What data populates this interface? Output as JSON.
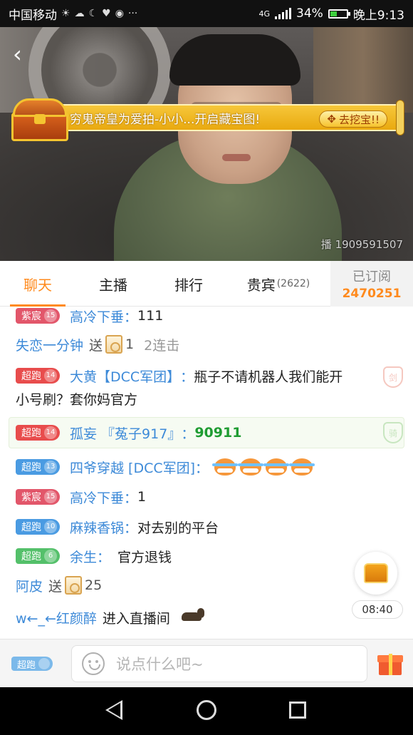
{
  "status_bar": {
    "carrier": "中国移动",
    "network": "4G",
    "battery": "34%",
    "time": "晚上9:13"
  },
  "stream": {
    "watermark": "播 1909591507"
  },
  "banner": {
    "text_parts": [
      "穷鬼帝皇",
      " 为 ",
      "爱拍-小小...",
      "开启藏宝图!"
    ],
    "dig_label": "去挖宝!!"
  },
  "tabs": [
    {
      "label": "聊天",
      "active": true
    },
    {
      "label": "主播"
    },
    {
      "label": "排行"
    },
    {
      "label": "贵宾",
      "count": "(2622)"
    }
  ],
  "subscribe": {
    "label": "已订阅",
    "count": "2470251"
  },
  "chat": [
    {
      "badge": "紫宸",
      "level": "15",
      "user": "高冷下垂",
      "text": "111"
    },
    {
      "user": "失恋一分钟",
      "action": "送",
      "gift_count": "1",
      "combo": "2连击"
    },
    {
      "badge": "超跑",
      "level": "14",
      "user": "大黄【DCC军团】",
      "text": "瓶子不请机器人我们能开",
      "text2": "小号刷？套你妈官方",
      "shield": "剑"
    },
    {
      "badge": "超跑",
      "level": "14",
      "user": "孤妄 『菟子917』",
      "text": "90911",
      "shield": "骑"
    },
    {
      "badge": "超跑",
      "level": "13",
      "user": "四爷穿越 [DCC军团]",
      "emoji_count": 4
    },
    {
      "badge": "紫宸",
      "level": "15",
      "user": "高冷下垂",
      "text": "1"
    },
    {
      "badge": "超跑",
      "level": "10",
      "user": "麻辣香锅",
      "text": "对去别的平台"
    },
    {
      "badge": "超跑",
      "level": "6",
      "user": "余生",
      "text": "官方退钱"
    },
    {
      "user": "阿皮",
      "action": "送",
      "gift_count": "25"
    },
    {
      "user": "w←_←红颜醉",
      "text": "进入直播间"
    }
  ],
  "timer": "08:40",
  "input": {
    "badge": "超跑",
    "placeholder": "说点什么吧~"
  }
}
